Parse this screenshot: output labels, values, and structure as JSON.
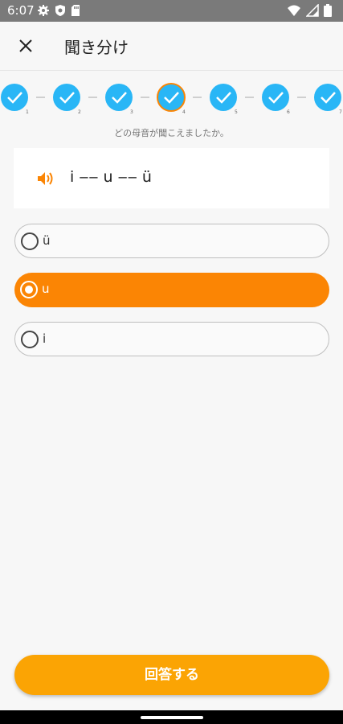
{
  "status_bar": {
    "time": "6:07",
    "left_icons": [
      "gear-icon",
      "shield-icon",
      "sd-card-icon"
    ],
    "right_icons": [
      "wifi-icon",
      "signal-icon",
      "battery-icon"
    ]
  },
  "header": {
    "title": "聞き分け",
    "close_icon": "close-icon"
  },
  "progress": {
    "steps": [
      {
        "number": "1",
        "state": "done"
      },
      {
        "number": "2",
        "state": "done"
      },
      {
        "number": "3",
        "state": "done"
      },
      {
        "number": "4",
        "state": "current"
      },
      {
        "number": "5",
        "state": "done"
      },
      {
        "number": "6",
        "state": "done"
      },
      {
        "number": "7",
        "state": "done"
      }
    ],
    "colors": {
      "fill": "#29b6f6",
      "current_ring": "#fb8504",
      "connector": "#cfcfcf"
    }
  },
  "question": {
    "text": "どの母音が聞こえましたか。",
    "prompt": "i ‒‒ u ‒‒ ü",
    "speaker_icon": "speaker-icon"
  },
  "options": [
    {
      "label": "ü",
      "selected": false
    },
    {
      "label": "u",
      "selected": true
    },
    {
      "label": "i",
      "selected": false
    }
  ],
  "answer_button": {
    "label": "回答する"
  },
  "colors": {
    "accent_orange": "#fb8504",
    "button_orange": "#fba404",
    "status_bar": "#7a7a7a"
  }
}
